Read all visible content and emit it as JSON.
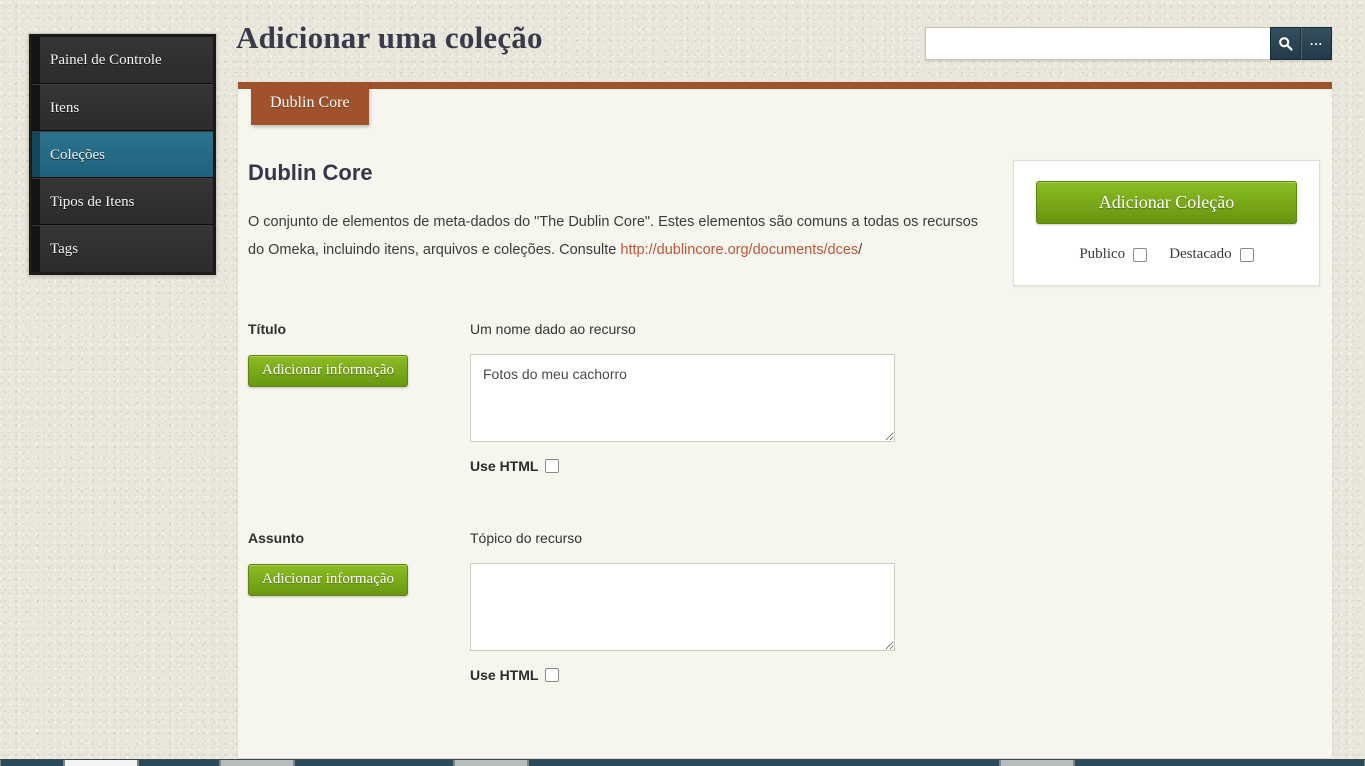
{
  "header": {
    "title": "Adicionar uma coleção",
    "search": {
      "value": "",
      "placeholder": "",
      "search_icon": "search-icon",
      "more_icon": "ellipsis-icon",
      "more_label": "..."
    }
  },
  "sidebar": {
    "items": [
      {
        "label": "Painel de Controle",
        "active": false
      },
      {
        "label": "Itens",
        "active": false
      },
      {
        "label": "Coleções",
        "active": true
      },
      {
        "label": "Tipos de Itens",
        "active": false
      },
      {
        "label": "Tags",
        "active": false
      }
    ]
  },
  "tabs": [
    {
      "label": "Dublin Core",
      "active": true
    }
  ],
  "main": {
    "heading": "Dublin Core",
    "description_before": "O conjunto de elementos de meta-dados do \"The Dublin Core\". Estes elementos são comuns a todas os recursos do Omeka, incluindo itens, arquivos e coleções. Consulte ",
    "description_link": "http://dublincore.org/documents/dces",
    "description_after": "/",
    "fields": [
      {
        "label": "Título",
        "add_button": "Adicionar informação",
        "hint": "Um nome dado ao recurso",
        "value": "Fotos do meu cachorro",
        "placeholder": "",
        "use_html_label": "Use HTML",
        "use_html_checked": false
      },
      {
        "label": "Assunto",
        "add_button": "Adicionar informação",
        "hint": "Tópico do recurso",
        "value": "",
        "placeholder": "",
        "use_html_label": "Use HTML",
        "use_html_checked": false
      }
    ]
  },
  "right_panel": {
    "submit_label": "Adicionar Coleção",
    "options": [
      {
        "label": "Publico",
        "checked": false
      },
      {
        "label": "Destacado",
        "checked": false
      }
    ]
  },
  "colors": {
    "accent_brown": "#a0522d",
    "accent_green": "#76a414",
    "active_nav": "#1f6a87",
    "link": "#c0563a",
    "search_button": "#2b4354",
    "taskbar": "#2d4a58"
  }
}
